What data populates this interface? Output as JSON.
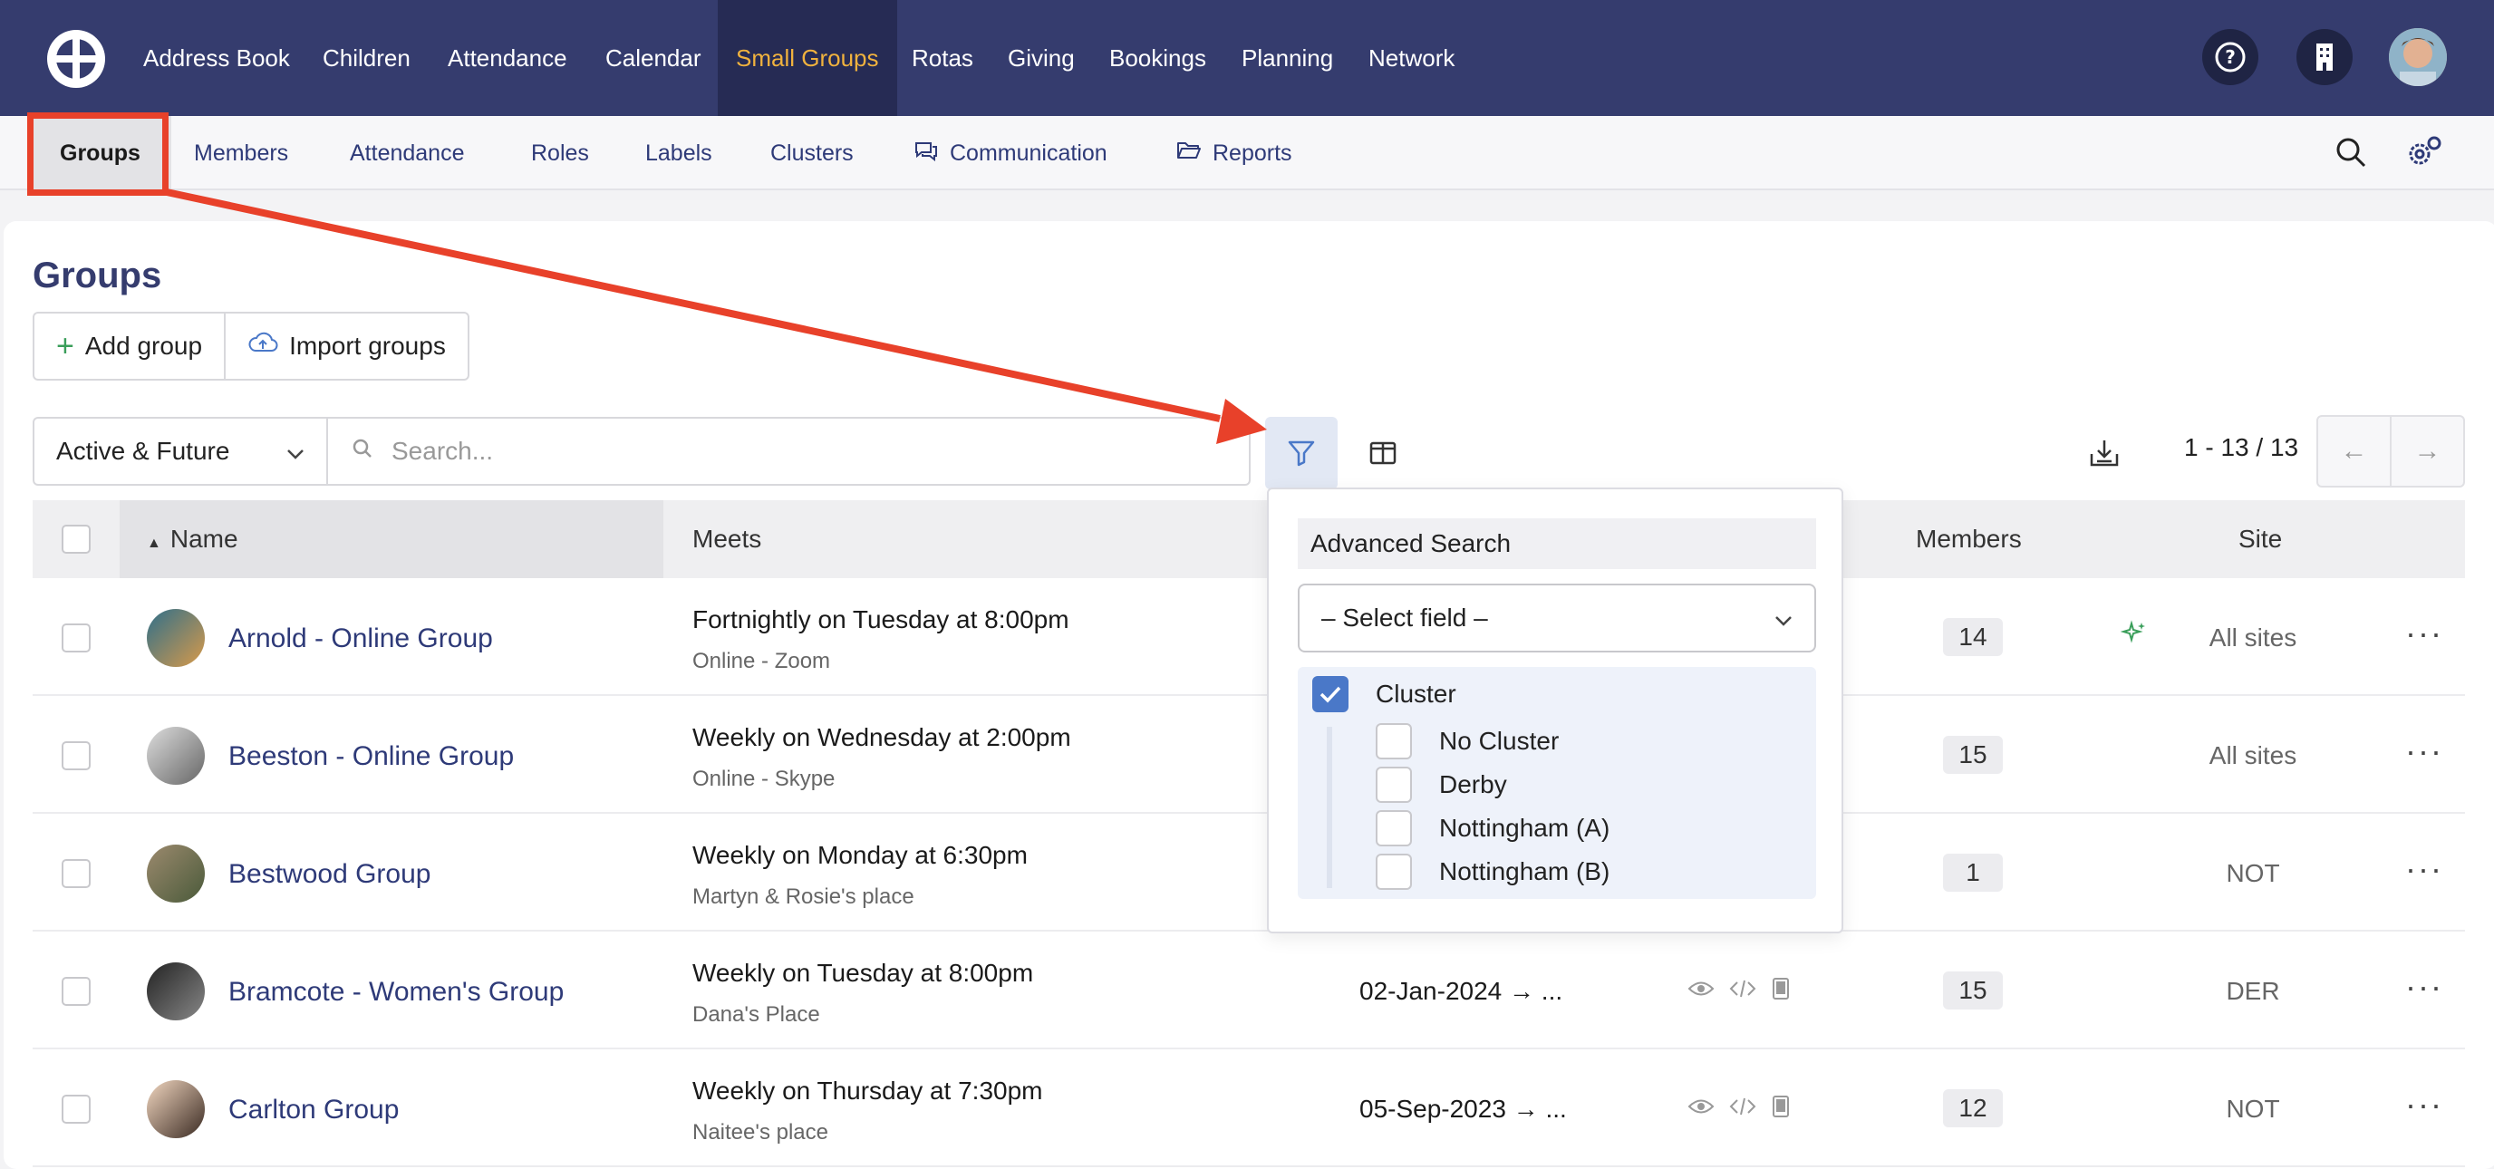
{
  "topnav": {
    "items": [
      "Address Book",
      "Children",
      "Attendance",
      "Calendar",
      "Small Groups",
      "Rotas",
      "Giving",
      "Bookings",
      "Planning",
      "Network"
    ],
    "active": "Small Groups"
  },
  "subnav": {
    "items": [
      "Groups",
      "Members",
      "Attendance",
      "Roles",
      "Labels",
      "Clusters",
      "Communication",
      "Reports"
    ]
  },
  "page": {
    "title": "Groups",
    "add_button": "Add group",
    "import_button": "Import groups"
  },
  "filters": {
    "status_value": "Active & Future",
    "search_placeholder": "Search..."
  },
  "pager": {
    "text": "1 - 13 / 13"
  },
  "table": {
    "headers": {
      "name": "Name",
      "meets": "Meets",
      "members": "Members",
      "site": "Site"
    },
    "rows": [
      {
        "name": "Arnold - Online Group",
        "meets": "Fortnightly on Tuesday at 8:00pm",
        "where": "Online - Zoom",
        "dates": "",
        "members": "14",
        "site": "All sites",
        "spark": true
      },
      {
        "name": "Beeston - Online Group",
        "meets": "Weekly on Wednesday at 2:00pm",
        "where": "Online - Skype",
        "dates": "",
        "members": "15",
        "site": "All sites",
        "spark": false
      },
      {
        "name": "Bestwood Group",
        "meets": "Weekly on Monday at 6:30pm",
        "where": "Martyn & Rosie's place",
        "dates": "",
        "members": "1",
        "site": "NOT",
        "spark": false
      },
      {
        "name": "Bramcote - Women's Group",
        "meets": "Weekly on Tuesday at 8:00pm",
        "where": "Dana's Place",
        "dates": "02-Jan-2024 → ...",
        "members": "15",
        "site": "DER",
        "spark": false
      },
      {
        "name": "Carlton Group",
        "meets": "Weekly on Thursday at 7:30pm",
        "where": "Naitee's place",
        "dates": "05-Sep-2023 → ...",
        "members": "12",
        "site": "NOT",
        "spark": false
      }
    ]
  },
  "advanced_search": {
    "heading": "Advanced Search",
    "select_placeholder": "– Select field –",
    "cluster_label": "Cluster",
    "options": [
      "No Cluster",
      "Derby",
      "Nottingham (A)",
      "Nottingham (B)"
    ]
  },
  "colors": {
    "nav_bg": "#353c6e",
    "nav_active_text": "#f0b23e",
    "link": "#2e3a78",
    "annotation": "#e8412a",
    "checkbox_checked": "#4a78c8"
  }
}
